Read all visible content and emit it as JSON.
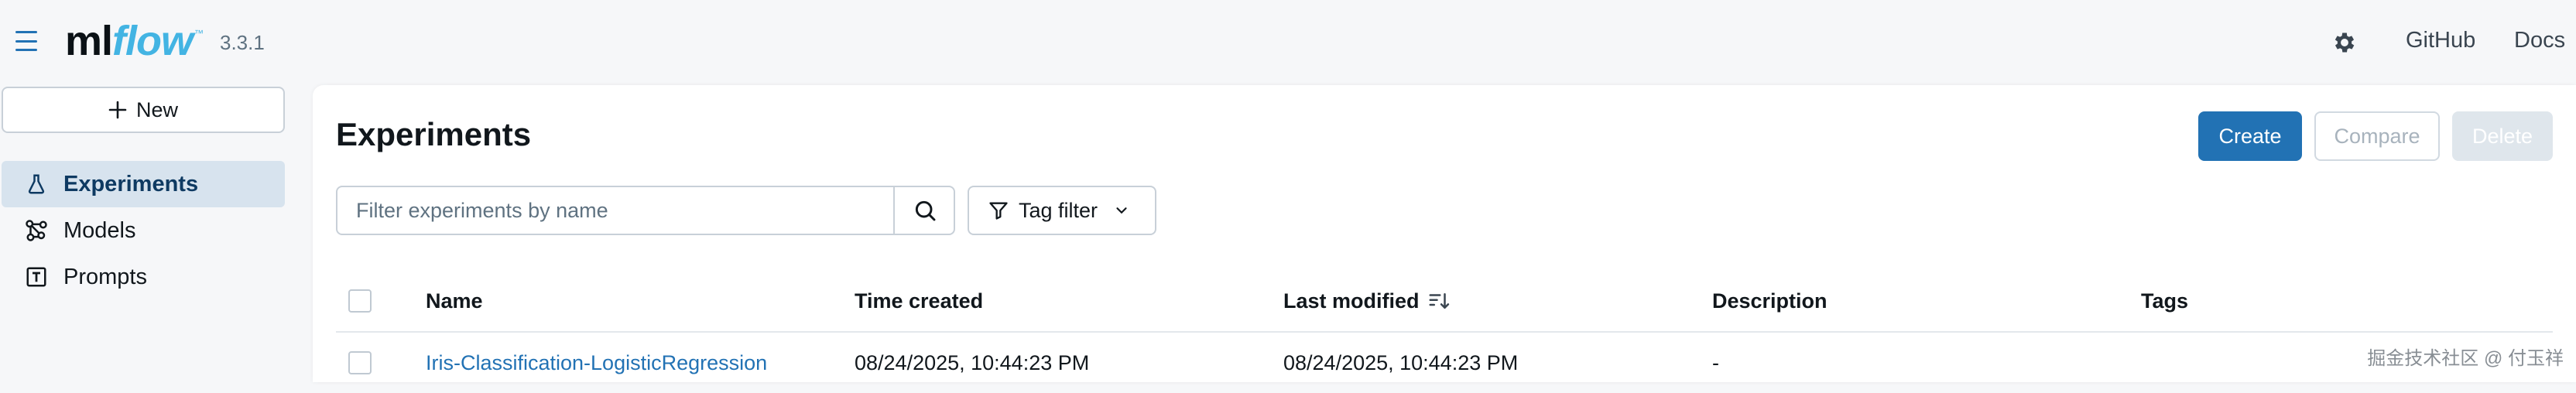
{
  "app": {
    "logo_ml": "ml",
    "logo_flow": "flow",
    "logo_tm": "™",
    "version": "3.3.1"
  },
  "header": {
    "github_label": "GitHub",
    "docs_label": "Docs",
    "settings_icon": "gear-icon"
  },
  "sidebar": {
    "new_label": "New",
    "items": [
      {
        "label": "Experiments",
        "icon": "beaker-icon",
        "active": true
      },
      {
        "label": "Models",
        "icon": "models-icon",
        "active": false
      },
      {
        "label": "Prompts",
        "icon": "text-box-icon",
        "active": false
      }
    ]
  },
  "main": {
    "title": "Experiments",
    "buttons": {
      "create": "Create",
      "compare": "Compare",
      "delete": "Delete"
    },
    "search": {
      "placeholder": "Filter experiments by name",
      "value": ""
    },
    "tag_filter_label": "Tag filter",
    "table": {
      "columns": [
        "Name",
        "Time created",
        "Last modified",
        "Description",
        "Tags"
      ],
      "rows": [
        {
          "name": "Iris-Classification-LogisticRegression",
          "time_created": "08/24/2025, 10:44:23 PM",
          "last_modified": "08/24/2025, 10:44:23 PM",
          "description": "-",
          "tags": ""
        }
      ]
    }
  },
  "watermark": "掘金技术社区 @ 付玉祥",
  "colors": {
    "accent": "#2272b4",
    "sidebar_active_bg": "#d7e3ee",
    "page_bg": "#f6f7f9"
  }
}
